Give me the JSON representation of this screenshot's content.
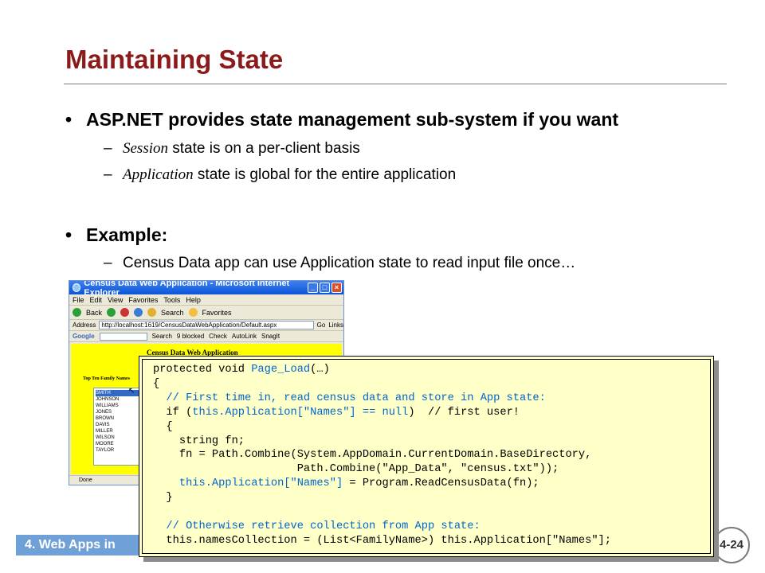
{
  "slide": {
    "title": "Maintaining State",
    "bullets": [
      {
        "text": "ASP.NET provides state management sub-system if you want"
      },
      {
        "text": "Example:"
      }
    ],
    "sub_items": [
      {
        "italic": "Session",
        "rest": " state is on a per-client basis"
      },
      {
        "italic": "Application",
        "rest": " state is global for the entire application"
      },
      {
        "text": "Census Data app can use Application state to read input file once…"
      }
    ],
    "bullet_glyph": "•",
    "dash_glyph": "–"
  },
  "browser": {
    "title": "Census Data Web Application - Microsoft Internet Explorer",
    "menu": [
      "File",
      "Edit",
      "View",
      "Favorites",
      "Tools",
      "Help"
    ],
    "toolbar": [
      "Back",
      "Search",
      "Favorites"
    ],
    "address_label": "Address",
    "address_value": "http://localhost:1619/CensusDataWebApplication/Default.aspx",
    "go_label": "Go",
    "links_label": "Links",
    "google_label": "Google",
    "google_items": [
      "Search",
      "9 blocked",
      "Check",
      "AutoLink",
      "SnagIt"
    ],
    "page_heading": "Census Data Web Application",
    "top_ten_label": "Top Ten Family Names",
    "names": [
      "SMITH",
      "JOHNSON",
      "WILLIAMS",
      "JONES",
      "BROWN",
      "DAVIS",
      "MILLER",
      "WILSON",
      "MOORE",
      "TAYLOR"
    ],
    "selected_name": "SMITH",
    "status": "Done"
  },
  "code": {
    "lines": [
      {
        "segments": [
          {
            "t": "protected void ",
            "cls": "k"
          },
          {
            "t": "Page_Load",
            "cls": "c"
          },
          {
            "t": "(…)",
            "cls": "k"
          }
        ]
      },
      {
        "segments": [
          {
            "t": "{",
            "cls": "k"
          }
        ]
      },
      {
        "segments": [
          {
            "t": "  // First time in, read census data and store in App state:",
            "cls": "c"
          }
        ]
      },
      {
        "segments": [
          {
            "t": "  if (",
            "cls": "k"
          },
          {
            "t": "this.Application[\"Names\"] == null",
            "cls": "c"
          },
          {
            "t": ")  // first user!",
            "cls": "k"
          }
        ]
      },
      {
        "segments": [
          {
            "t": "  {",
            "cls": "k"
          }
        ]
      },
      {
        "segments": [
          {
            "t": "    string fn;",
            "cls": "k"
          }
        ]
      },
      {
        "segments": [
          {
            "t": "    fn = Path.Combine(System.AppDomain.CurrentDomain.BaseDirectory,",
            "cls": "k"
          }
        ]
      },
      {
        "segments": [
          {
            "t": "                      Path.Combine(\"App_Data\", \"census.txt\"));",
            "cls": "k"
          }
        ]
      },
      {
        "segments": [
          {
            "t": "    this.Application[\"Names\"]",
            "cls": "c"
          },
          {
            "t": " = Program.ReadCensusData(fn);",
            "cls": "k"
          }
        ]
      },
      {
        "segments": [
          {
            "t": "  }",
            "cls": "k"
          }
        ]
      },
      {
        "segments": [
          {
            "t": "",
            "cls": "k"
          }
        ]
      },
      {
        "segments": [
          {
            "t": "  // Otherwise retrieve collection from App state:",
            "cls": "c"
          }
        ]
      },
      {
        "segments": [
          {
            "t": "  this.namesCollection = (List<FamilyName>) this.Application[\"Names\"];",
            "cls": "k"
          }
        ]
      }
    ]
  },
  "footer": {
    "label": "4. Web Apps in",
    "page_number": "4-24"
  },
  "colors": {
    "title": "#8b1a1a",
    "code_bg": "#ffffc8",
    "code_highlight": "#0066cc",
    "footer_bg": "#6fa0d8",
    "page_bg": "#ffff00"
  }
}
